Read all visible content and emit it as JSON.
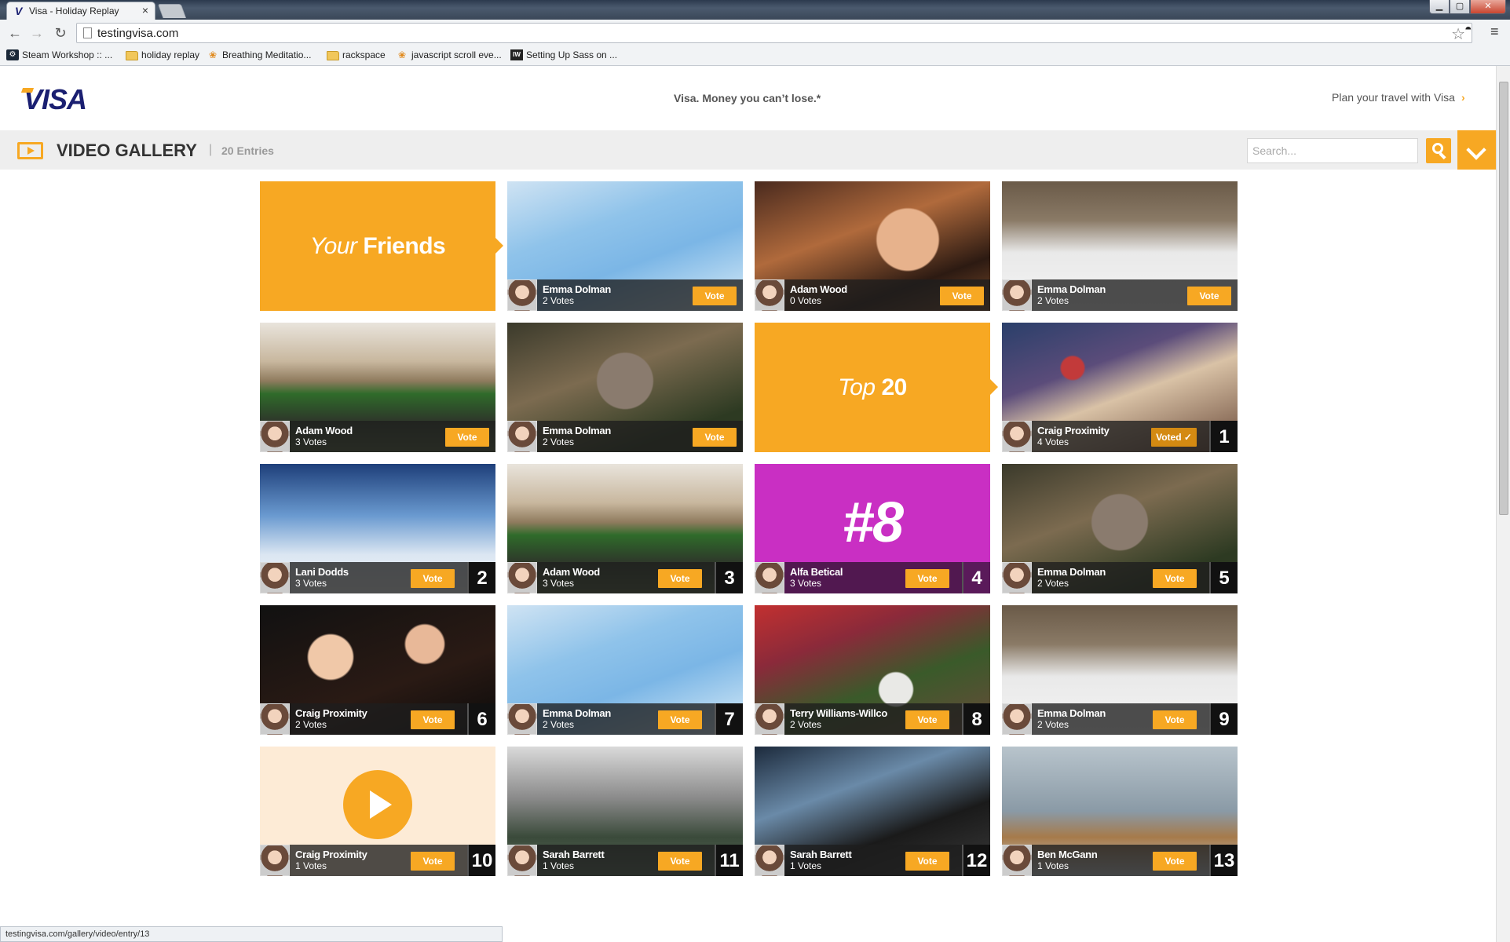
{
  "browser": {
    "tab_title": "Visa - Holiday Replay",
    "tab_favicon": "V",
    "url": "testingvisa.com",
    "bookmarks": [
      {
        "label": "Steam Workshop :: ...",
        "icon": "steam-icon"
      },
      {
        "label": "holiday replay",
        "icon": "folder-icon"
      },
      {
        "label": "Breathing Meditatio...",
        "icon": "lotus-icon"
      },
      {
        "label": "rackspace",
        "icon": "folder-icon"
      },
      {
        "label": "javascript scroll eve...",
        "icon": "lotus-icon"
      },
      {
        "label": "Setting Up Sass on ...",
        "icon": "iw-icon"
      }
    ],
    "status_url": "testingvisa.com/gallery/video/entry/13"
  },
  "header": {
    "logo": "VISA",
    "tagline": "Visa. Money you can’t lose.*",
    "plan_link": "Plan your travel with Visa"
  },
  "gallery": {
    "title": "VIDEO GALLERY",
    "separator": "|",
    "count": "20 Entries",
    "search_placeholder": "Search..."
  },
  "colors": {
    "accent": "#f7a823",
    "purple": "#c92fc3",
    "dark_overlay": "#1e1e1e",
    "visa_blue": "#1a1f71"
  },
  "promos": [
    {
      "italic": "Your",
      "bold": "Friends"
    },
    {
      "italic": "Top",
      "bold": "20"
    }
  ],
  "entries": [
    {
      "name": "Emma Dolman",
      "votes": "2 Votes",
      "vote_label": "Vote",
      "rank": ""
    },
    {
      "name": "Adam Wood",
      "votes": "0 Votes",
      "vote_label": "Vote",
      "rank": ""
    },
    {
      "name": "Emma Dolman",
      "votes": "2 Votes",
      "vote_label": "Vote",
      "rank": ""
    },
    {
      "name": "Adam Wood",
      "votes": "3 Votes",
      "vote_label": "Vote",
      "rank": ""
    },
    {
      "name": "Emma Dolman",
      "votes": "2 Votes",
      "vote_label": "Vote",
      "rank": ""
    },
    {
      "name": "Craig Proximity",
      "votes": "4 Votes",
      "vote_label": "Voted ✓",
      "rank": "1"
    },
    {
      "name": "Lani Dodds",
      "votes": "3 Votes",
      "vote_label": "Vote",
      "rank": "2"
    },
    {
      "name": "Adam Wood",
      "votes": "3 Votes",
      "vote_label": "Vote",
      "rank": "3"
    },
    {
      "name": "Alfa Betical",
      "votes": "3 Votes",
      "vote_label": "Vote",
      "rank": "4",
      "overlay_text": "#8"
    },
    {
      "name": "Emma Dolman",
      "votes": "2 Votes",
      "vote_label": "Vote",
      "rank": "5"
    },
    {
      "name": "Craig Proximity",
      "votes": "2 Votes",
      "vote_label": "Vote",
      "rank": "6"
    },
    {
      "name": "Emma Dolman",
      "votes": "2 Votes",
      "vote_label": "Vote",
      "rank": "7"
    },
    {
      "name": "Terry Williams-Willco",
      "votes": "2 Votes",
      "vote_label": "Vote",
      "rank": "8"
    },
    {
      "name": "Emma Dolman",
      "votes": "2 Votes",
      "vote_label": "Vote",
      "rank": "9"
    },
    {
      "name": "Craig Proximity",
      "votes": "1 Votes",
      "vote_label": "Vote",
      "rank": "10"
    },
    {
      "name": "Sarah Barrett",
      "votes": "1 Votes",
      "vote_label": "Vote",
      "rank": "11"
    },
    {
      "name": "Sarah Barrett",
      "votes": "1 Votes",
      "vote_label": "Vote",
      "rank": "12"
    },
    {
      "name": "Ben McGann",
      "votes": "1 Votes",
      "vote_label": "Vote",
      "rank": "13"
    }
  ]
}
